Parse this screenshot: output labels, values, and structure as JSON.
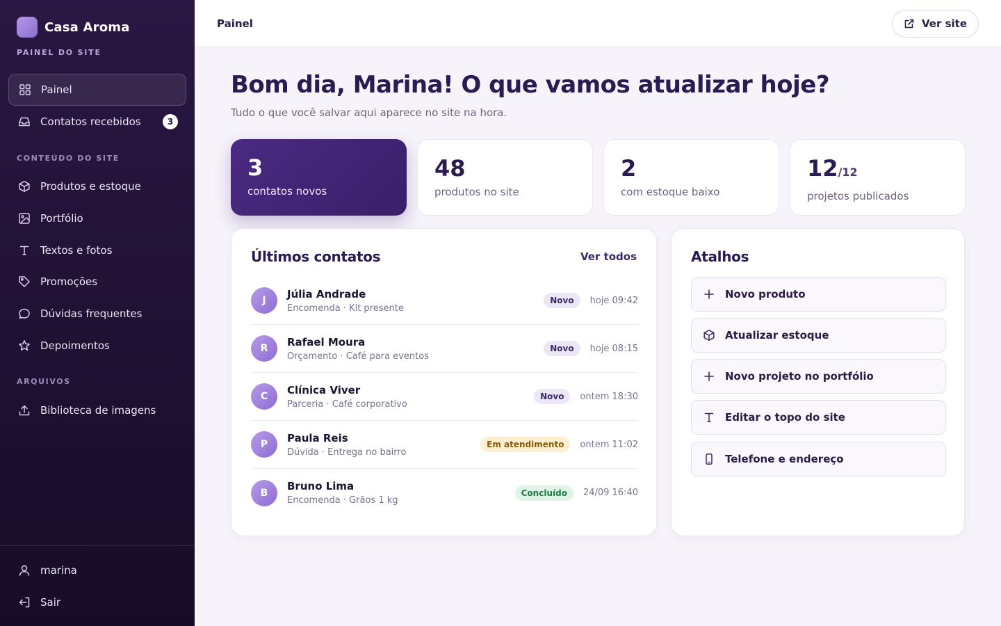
{
  "brand": {
    "name": "Casa Aroma",
    "subtitle": "PAINEL DO SITE"
  },
  "sidebar": {
    "main": [
      {
        "label": "Painel",
        "icon": "grid-icon",
        "active": true
      },
      {
        "label": "Contatos recebidos",
        "icon": "inbox-icon",
        "badge": "3"
      }
    ],
    "content_section": "CONTEÚDO DO SITE",
    "content": [
      {
        "label": "Produtos e estoque",
        "icon": "box-icon"
      },
      {
        "label": "Portfólio",
        "icon": "image-icon"
      },
      {
        "label": "Textos e fotos",
        "icon": "text-icon"
      },
      {
        "label": "Promoções",
        "icon": "tag-icon"
      },
      {
        "label": "Dúvidas frequentes",
        "icon": "chat-icon"
      },
      {
        "label": "Depoimentos",
        "icon": "star-icon"
      }
    ],
    "files_section": "ARQUIVOS",
    "files": [
      {
        "label": "Biblioteca de imagens",
        "icon": "upload-icon"
      }
    ],
    "footer": [
      {
        "label": "marina",
        "icon": "user-icon"
      },
      {
        "label": "Sair",
        "icon": "logout-icon"
      }
    ]
  },
  "header": {
    "title": "Painel",
    "view_site": "Ver site"
  },
  "main": {
    "greeting": "Bom dia, Marina! O que vamos atualizar hoje?",
    "subtitle": "Tudo o que você salvar aqui aparece no site na hora.",
    "stats": [
      {
        "value": "3",
        "label": "contatos novos"
      },
      {
        "value": "48",
        "label": "produtos no site"
      },
      {
        "value": "2",
        "label": "com estoque baixo"
      },
      {
        "value": "12",
        "denominator": "/12",
        "label": "projetos publicados"
      }
    ]
  },
  "contacts": {
    "title": "Últimos contatos",
    "view_all": "Ver todos",
    "items": [
      {
        "initial": "J",
        "name": "Júlia Andrade",
        "detail": "Encomenda · Kit presente",
        "status": "Novo",
        "status_type": "novo",
        "time": "hoje 09:42"
      },
      {
        "initial": "R",
        "name": "Rafael Moura",
        "detail": "Orçamento · Café para eventos",
        "status": "Novo",
        "status_type": "novo",
        "time": "hoje 08:15"
      },
      {
        "initial": "C",
        "name": "Clínica Viver",
        "detail": "Parceria · Café corporativo",
        "status": "Novo",
        "status_type": "novo",
        "time": "ontem 18:30"
      },
      {
        "initial": "P",
        "name": "Paula Reis",
        "detail": "Dúvida · Entrega no bairro",
        "status": "Em atendimento",
        "status_type": "atend",
        "time": "ontem 11:02"
      },
      {
        "initial": "B",
        "name": "Bruno Lima",
        "detail": "Encomenda · Grãos 1 kg",
        "status": "Concluído",
        "status_type": "concl",
        "time": "24/09 16:40"
      }
    ]
  },
  "shortcuts": {
    "title": "Atalhos",
    "items": [
      {
        "label": "Novo produto",
        "icon": "plus-icon"
      },
      {
        "label": "Atualizar estoque",
        "icon": "box-icon"
      },
      {
        "label": "Novo projeto no portfólio",
        "icon": "plus-icon"
      },
      {
        "label": "Editar o topo do site",
        "icon": "text-icon"
      },
      {
        "label": "Telefone e endereço",
        "icon": "phone-icon"
      }
    ]
  }
}
